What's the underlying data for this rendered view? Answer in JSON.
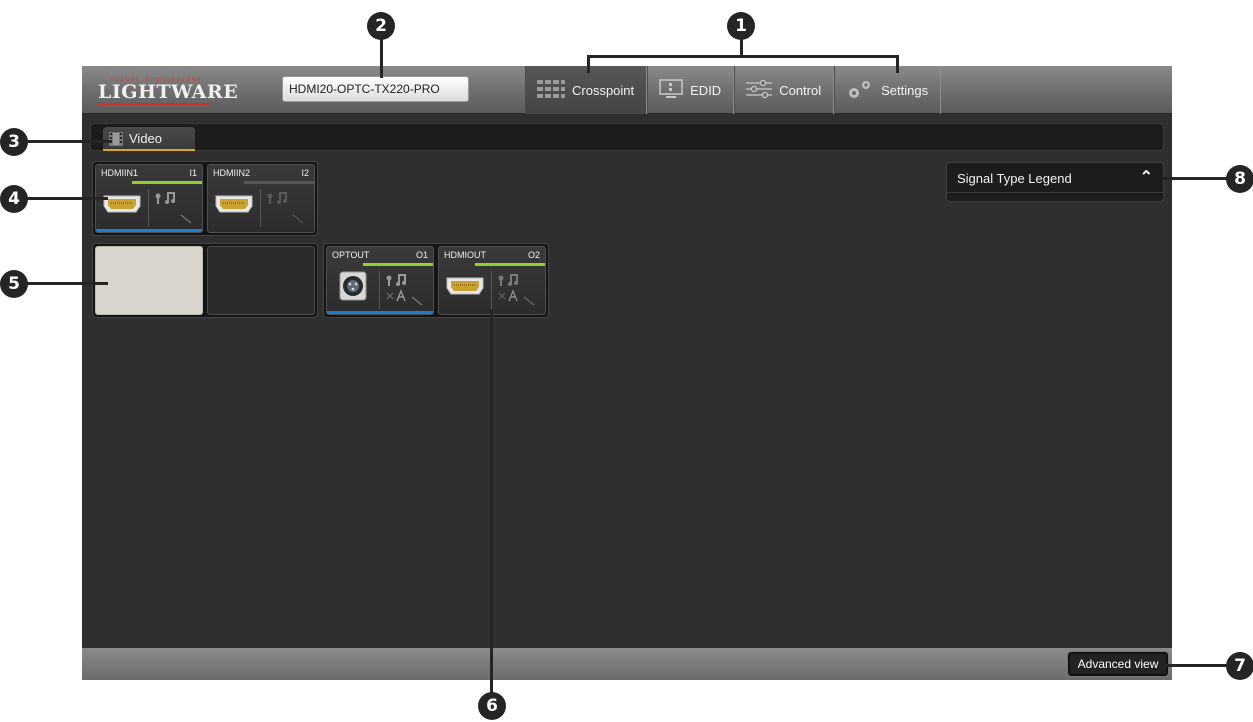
{
  "logo": {
    "tagline": "visual engineering",
    "wordmark": "LIGHTWARE"
  },
  "device": {
    "name": "HDMI20-OPTC-TX220-PRO"
  },
  "nav": {
    "tabs": [
      {
        "label": "Crosspoint",
        "icon": "grid-icon",
        "active": true
      },
      {
        "label": "EDID",
        "icon": "monitor-icon",
        "active": false
      },
      {
        "label": "Control",
        "icon": "sliders-icon",
        "active": false
      },
      {
        "label": "Settings",
        "icon": "gears-icon",
        "active": false
      }
    ]
  },
  "subtabs": {
    "video_label": "Video"
  },
  "inputs": [
    {
      "name": "HDMIIN1",
      "id": "I1",
      "signal": true,
      "connected": true,
      "connector": "hdmi"
    },
    {
      "name": "HDMIIN2",
      "id": "I2",
      "signal": false,
      "connected": false,
      "connector": "hdmi"
    }
  ],
  "outputs": [
    {
      "name": "OPTOUT",
      "id": "O1",
      "signal": true,
      "connected": true,
      "connector": "optical"
    },
    {
      "name": "HDMIOUT",
      "id": "O2",
      "signal": true,
      "connected": false,
      "connector": "hdmi"
    }
  ],
  "legend": {
    "title": "Signal Type Legend"
  },
  "footer": {
    "advanced_label": "Advanced view"
  },
  "callouts": [
    "1",
    "2",
    "3",
    "4",
    "5",
    "6",
    "7",
    "8"
  ],
  "colors": {
    "signal_green": "#8fd12a",
    "connected_blue": "#1f7ad3",
    "video_tab_accent": "#d9a925",
    "logo_red": "#c8322d"
  }
}
